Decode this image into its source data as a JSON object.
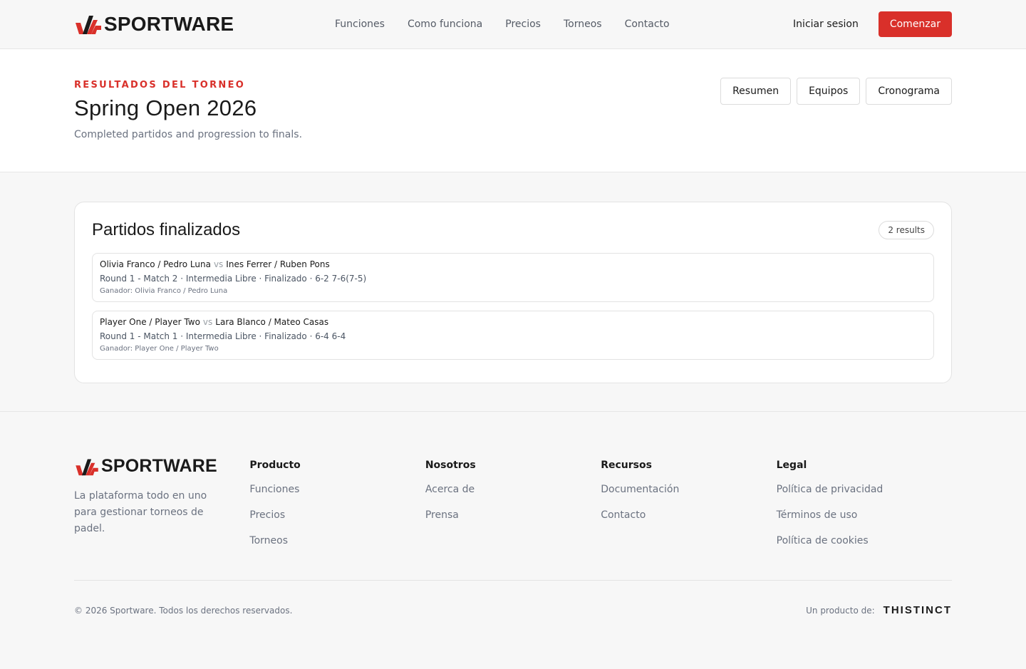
{
  "brand": {
    "name": "SPORTWARE",
    "accent": "#d9302a"
  },
  "nav": {
    "links": [
      "Funciones",
      "Como funciona",
      "Precios",
      "Torneos",
      "Contacto"
    ],
    "login": "Iniciar sesion",
    "cta": "Comenzar"
  },
  "hero": {
    "eyebrow": "RESULTADOS DEL TORNEO",
    "title": "Spring Open 2026",
    "subtitle": "Completed partidos and progression to finals.",
    "tabs": [
      "Resumen",
      "Equipos",
      "Cronograma"
    ]
  },
  "results": {
    "title": "Partidos finalizados",
    "count": "2 results",
    "vs": "vs",
    "matches": [
      {
        "team_a": "Olivia Franco / Pedro Luna",
        "team_b": "Ines Ferrer / Ruben Pons",
        "meta": "Round 1 - Match 2 · Intermedia Libre · Finalizado · 6-2 7-6(7-5)",
        "winner": "Ganador: Olivia Franco / Pedro Luna"
      },
      {
        "team_a": "Player One / Player Two",
        "team_b": "Lara Blanco / Mateo Casas",
        "meta": "Round 1 - Match 1 · Intermedia Libre · Finalizado · 6-4 6-4",
        "winner": "Ganador: Player One / Player Two"
      }
    ]
  },
  "footer": {
    "description": "La plataforma todo en uno para gestionar torneos de padel.",
    "columns": [
      {
        "title": "Producto",
        "items": [
          "Funciones",
          "Precios",
          "Torneos"
        ]
      },
      {
        "title": "Nosotros",
        "items": [
          "Acerca de",
          "Prensa"
        ]
      },
      {
        "title": "Recursos",
        "items": [
          "Documentación",
          "Contacto"
        ]
      },
      {
        "title": "Legal",
        "items": [
          "Política de privacidad",
          "Términos de uso",
          "Política de cookies"
        ]
      }
    ],
    "copyright": "© 2026 Sportware. Todos los derechos reservados.",
    "product_by": "Un producto de:",
    "company": "THISTINCT"
  }
}
